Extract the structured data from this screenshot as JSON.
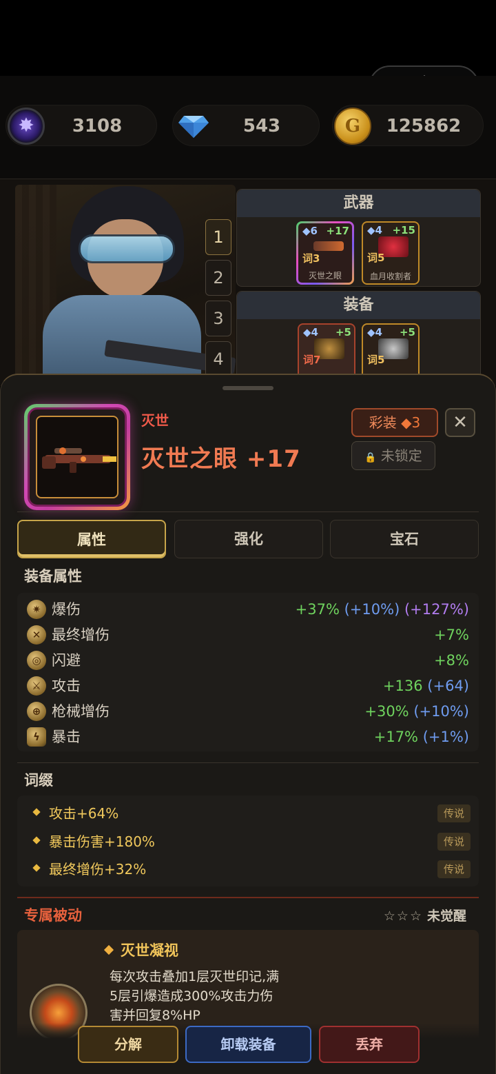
{
  "currencies": [
    {
      "name": "crystal",
      "icon": "purple-crystal-icon",
      "value": "3108"
    },
    {
      "name": "diamond",
      "icon": "diamond-icon",
      "value": "543"
    },
    {
      "name": "gold",
      "icon": "gold-coin-icon",
      "value": "125862"
    }
  ],
  "loadout_tabs": [
    "1",
    "2",
    "3",
    "4"
  ],
  "weapon_panel": {
    "title": "武器",
    "slots": [
      {
        "level": "◆6",
        "plus": "+17",
        "affix": "词3",
        "name": "灭世之眼",
        "frame": "rainbow"
      },
      {
        "level": "◆4",
        "plus": "+15",
        "affix": "词5",
        "name": "血月收割者",
        "frame": "gold"
      }
    ]
  },
  "equip_panel": {
    "title": "装备",
    "slots": [
      {
        "level": "◆4",
        "plus": "+5",
        "affix": "词7",
        "name": "",
        "frame": "red"
      },
      {
        "level": "◆4",
        "plus": "+5",
        "affix": "词5",
        "name": "",
        "frame": "gold"
      }
    ]
  },
  "item": {
    "set_name": "灭世",
    "name": "灭世之眼 +17",
    "rarity_label": "彩装",
    "rarity_level": "◆3",
    "lock_label": "未锁定",
    "close_label": "✕"
  },
  "detail_tabs": {
    "attrs": "属性",
    "enhance": "强化",
    "gem": "宝石"
  },
  "attributes": {
    "title": "装备属性",
    "rows": [
      {
        "icon": "crit-damage-icon",
        "name": "爆伤",
        "base": "+37%",
        "bonus1": "(+10%)",
        "bonus2": "(+127%)"
      },
      {
        "icon": "final-damage-icon",
        "name": "最终增伤",
        "base": "+7%",
        "bonus1": "",
        "bonus2": ""
      },
      {
        "icon": "dodge-icon",
        "name": "闪避",
        "base": "+8%",
        "bonus1": "",
        "bonus2": ""
      },
      {
        "icon": "attack-icon",
        "name": "攻击",
        "base": "+136",
        "bonus1": "(+64)",
        "bonus2": ""
      },
      {
        "icon": "gun-damage-icon",
        "name": "枪械增伤",
        "base": "+30%",
        "bonus1": "(+10%)",
        "bonus2": ""
      },
      {
        "icon": "crit-icon",
        "name": "暴击",
        "base": "+17%",
        "bonus1": "(+1%)",
        "bonus2": ""
      }
    ]
  },
  "affixes": {
    "title": "词缀",
    "rows": [
      {
        "text": "攻击+64%",
        "tag": "传说"
      },
      {
        "text": "暴击伤害+180%",
        "tag": "传说"
      },
      {
        "text": "最终增伤+32%",
        "tag": "传说"
      }
    ]
  },
  "passive": {
    "title": "专属被动",
    "stars": "☆☆☆",
    "awaken_status": "未觉醒",
    "skill_name": "灭世凝视",
    "description_lines": [
      "每次攻击叠加1层灭世印记,满",
      "5层引爆造成300%攻击力伤",
      "害并回复8%HP"
    ]
  },
  "actions": {
    "decompose": "分解",
    "unequip": "卸载装备",
    "discard": "丢弃"
  },
  "colors": {
    "green": "#6fd35e",
    "blue": "#6f9cf0",
    "purple": "#b27df0",
    "gold": "#f0c85c",
    "accent_red": "#e8613d"
  }
}
